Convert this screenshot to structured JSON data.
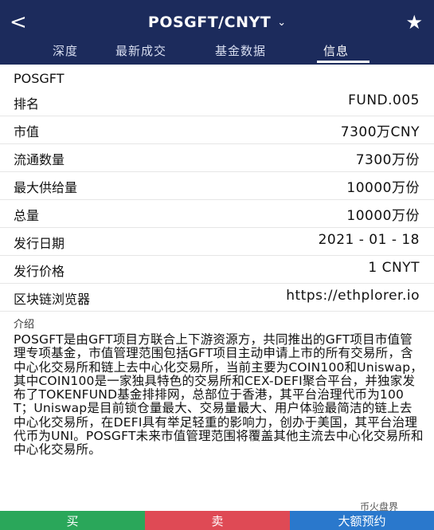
{
  "header": {
    "title": "POSGFT/CNYT",
    "back_symbol": "<",
    "caret_symbol": "⌄",
    "star_symbol": "★"
  },
  "tabs": [
    {
      "label": "深度"
    },
    {
      "label": "最新成交"
    },
    {
      "label": "基金数据"
    },
    {
      "label": "信息",
      "active": true
    }
  ],
  "fund": {
    "name": "POSGFT",
    "rows": [
      {
        "label": "排名",
        "value": "FUND.005"
      },
      {
        "label": "市值",
        "value": "7300万CNY"
      },
      {
        "label": "流通数量",
        "value": "7300万份"
      },
      {
        "label": "最大供给量",
        "value": "10000万份"
      },
      {
        "label": "总量",
        "value": "10000万份"
      },
      {
        "label": "发行日期",
        "value": "2021 - 01 - 18"
      },
      {
        "label": "发行价格",
        "value": "1 CNYT"
      },
      {
        "label": "区块链浏览器",
        "value": "https://ethplorer.io"
      }
    ]
  },
  "intro": {
    "title": "介绍",
    "text": "POSGFT是由GFT项目方联合上下游资源方，共同推出的GFT项目市值管理专项基金，市值管理范围包括GFT项目主动申请上市的所有交易所，含中心化交易所和链上去中心化交易所，当前主要为COIN100和Uniswap，其中COIN100是一家独具特色的交易所和CEX-DEFI聚合平台，并独家发布了TOKENFUND基金排排网，总部位于香港，其平台治理代币为100T；Uniswap是目前锁仓量最大、交易量最大、用户体验最简洁的链上去中心化交易所，在DEFI具有举足轻重的影响力，创办于美国，其平台治理代币为UNI。POSGFT未来市值管理范围将覆盖其他主流去中心化交易所和中心化交易所。"
  },
  "actions": {
    "buy": "买",
    "sell": "卖",
    "reserve": "大额预约"
  },
  "watermark": "币火盘界",
  "colors": {
    "header_bg": "#1c2b5c",
    "buy": "#2aa75a",
    "sell": "#df4a55",
    "reserve": "#2a78cc"
  }
}
